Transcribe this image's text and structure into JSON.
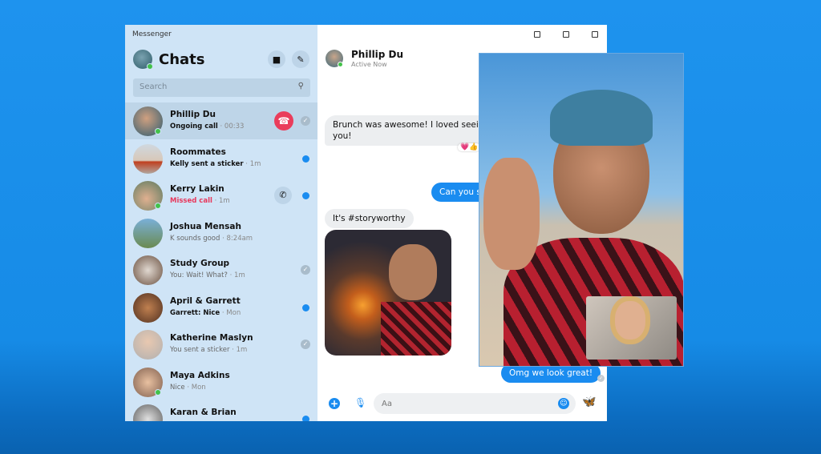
{
  "app": {
    "title": "Messenger"
  },
  "sidebar": {
    "heading": "Chats",
    "search_placeholder": "Search",
    "chats": [
      {
        "name": "Phillip Du",
        "preview": "Ongoing call",
        "time": "00:33",
        "online": true,
        "status": "ongoing-call"
      },
      {
        "name": "Roommates",
        "preview": "Kelly sent a sticker",
        "time": "1m",
        "unread": true
      },
      {
        "name": "Kerry Lakin",
        "preview": "Missed call",
        "time": "1m",
        "online": true,
        "unread": true,
        "status": "missed-call"
      },
      {
        "name": "Joshua Mensah",
        "preview": "K sounds good",
        "time": "8:24am"
      },
      {
        "name": "Study Group",
        "preview": "You: Wait! What?",
        "time": "1m",
        "seen": true
      },
      {
        "name": "April & Garrett",
        "preview": "Garrett: Nice",
        "time": "Mon",
        "unread": true
      },
      {
        "name": "Katherine Maslyn",
        "preview": "You sent a sticker",
        "time": "1m",
        "seen": true
      },
      {
        "name": "Maya Adkins",
        "preview": "Nice",
        "time": "Mon",
        "online": true
      },
      {
        "name": "Karan & Brian",
        "preview": "",
        "time": "",
        "unread": true
      }
    ]
  },
  "conversation": {
    "contact_name": "Phillip Du",
    "contact_status": "Active Now",
    "messages": [
      {
        "from": "them",
        "text": "Brunch was awesome! I loved seeing",
        "text2": "you!",
        "reactions": "💗👍"
      },
      {
        "from": "me",
        "text": "Can you s"
      },
      {
        "from": "them",
        "text": "It's #storyworthy"
      },
      {
        "from": "them",
        "type": "photo"
      },
      {
        "from": "me",
        "text": "Omg we look great!"
      }
    ],
    "composer_placeholder": "Aa"
  },
  "colors": {
    "accent": "#1a8cf0",
    "hangup": "#ea3d5b",
    "missed": "#e8385c",
    "online": "#43c24a",
    "sidebar_bg": "#cfe4f6"
  }
}
